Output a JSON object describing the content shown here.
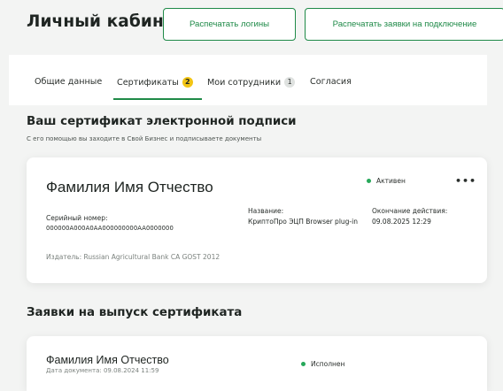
{
  "header": {
    "title": "Личный кабинет",
    "print_logins_label": "Распечатать логины",
    "print_requests_label": "Распечатать заявки на подключение"
  },
  "tabs": [
    {
      "label": "Общие данные",
      "badge": null,
      "active": false
    },
    {
      "label": "Сертификаты",
      "badge": "2",
      "active": true
    },
    {
      "label": "Мои сотрудники",
      "badge": "1",
      "active": false
    },
    {
      "label": "Согласия",
      "badge": null,
      "active": false
    }
  ],
  "certificate_section": {
    "title": "Ваш сертификат электронной подписи",
    "subtitle": "С его помощью вы заходите в Свой Бизнес и подписываете документы",
    "card": {
      "holder": "Фамилия Имя Отчество",
      "status": "Активен",
      "more": "•••",
      "serial_label": "Серийный номер:",
      "serial_value": "000000A000A0AA000000000AA0000000",
      "name_label": "Название:",
      "name_value": "КриптоПро ЭЦП Browser plug-in",
      "end_label": "Окончание действия:",
      "end_value": "09.08.2025 12:29",
      "issuer": "Издатель: Russian Agricultural Bank CA GOST 2012"
    }
  },
  "requests_section": {
    "title": "Заявки на выпуск сертификата",
    "card": {
      "holder": "Фамилия Имя Отчество",
      "date": "Дата документа: 09.08.2024 11:59",
      "status": "Исполнен"
    }
  },
  "colors": {
    "accent": "#1f8a48",
    "status_green": "#27a85a",
    "badge_yellow": "#f2c413"
  }
}
